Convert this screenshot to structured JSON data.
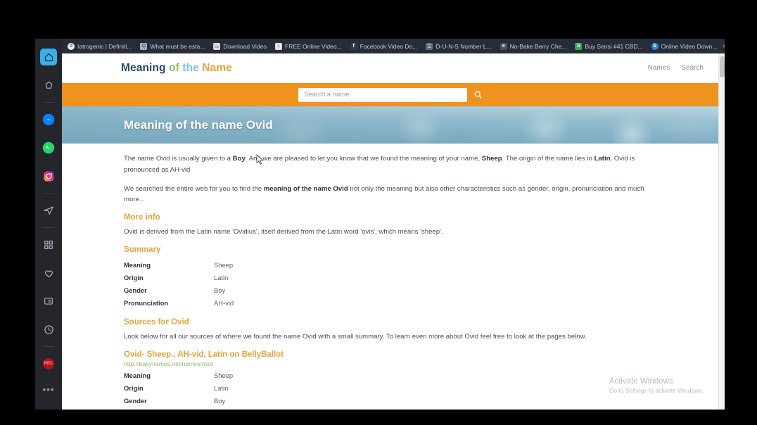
{
  "browser": {
    "bookmarks": [
      {
        "label": "Iatrogenic | Definiti...",
        "icon": "dictionary-icon",
        "color": "#e8e8e8"
      },
      {
        "label": "What must be esta...",
        "icon": "quora-icon",
        "color": "#8fa8c8"
      },
      {
        "label": "Download Video",
        "icon": "document-icon",
        "color": "#dcdcdc"
      },
      {
        "label": "FREE Online Video...",
        "icon": "download-icon",
        "color": "#e0e0e0"
      },
      {
        "label": "Facebook Video Do...",
        "icon": "facebook-icon",
        "color": "#3b5998"
      },
      {
        "label": "D-U-N-S Number L...",
        "icon": "page-icon",
        "color": "#6d7a8a"
      },
      {
        "label": "No-Bake Berry Che...",
        "icon": "recipe-icon",
        "color": "#55606e"
      },
      {
        "label": "Buy Sensi #41 CBD...",
        "icon": "leaf-icon",
        "color": "#3ea35a"
      },
      {
        "label": "Online Video Down...",
        "icon": "blue-s-icon",
        "color": "#2f86d6"
      }
    ],
    "overflow_label": "»"
  },
  "sidebar": {
    "items": [
      {
        "name": "home-icon",
        "label": "Home",
        "active": true
      },
      {
        "name": "star-icon",
        "label": "Favorites",
        "active": false
      },
      {
        "name": "messenger-icon",
        "label": "Messenger",
        "active": false
      },
      {
        "name": "whatsapp-icon",
        "label": "WhatsApp",
        "active": false
      },
      {
        "name": "instagram-icon",
        "label": "Instagram",
        "active": false
      },
      {
        "name": "telegram-icon",
        "label": "Telegram",
        "active": false
      },
      {
        "name": "apps-grid-icon",
        "label": "Apps",
        "active": false
      },
      {
        "name": "heart-icon",
        "label": "Likes",
        "active": false
      },
      {
        "name": "notes-icon",
        "label": "Notes",
        "active": false
      },
      {
        "name": "history-clock-icon",
        "label": "History",
        "active": false
      },
      {
        "name": "record-icon",
        "label": "Record",
        "active": false
      }
    ],
    "more_label": "•••"
  },
  "site": {
    "logo": {
      "word1": "Meaning",
      "word2": "of",
      "word3": "the",
      "word4": "Name"
    },
    "nav": [
      {
        "label": "Names"
      },
      {
        "label": "Search"
      }
    ],
    "search": {
      "placeholder": "Search a name",
      "value": "",
      "button_icon": "search-icon"
    },
    "hero_title": "Meaning of the name Ovid"
  },
  "content": {
    "intro_1": "The name Ovid is usually given to a ",
    "intro_bold_1": "Boy",
    "intro_2": ". And we are pleased to let you know that we found the meaning of your name, ",
    "intro_bold_2": "Sheep",
    "intro_3": ". The origin of the name lies in ",
    "intro_bold_3": "Latin",
    "intro_4": ". Ovid is pronounced as AH-vid",
    "search_1": "We searched the entire web for you to find the ",
    "search_bold": "meaning of the name Ovid",
    "search_2": " not only the meaning but also other characteristics such as gender, origin, pronunciation and much more...",
    "more_info_heading": "More info",
    "more_info_text": "Ovid is derived from the Latin name 'Ovidius', itself derived from the Latin word 'ovis', which means 'sheep'.",
    "summary_heading": "Summary",
    "summary_rows": [
      {
        "key": "Meaning",
        "value": "Sheep"
      },
      {
        "key": "Origin",
        "value": "Latin"
      },
      {
        "key": "Gender",
        "value": "Boy"
      },
      {
        "key": "Pronunciation",
        "value": "AH-vid"
      }
    ],
    "sources_heading": "Sources for Ovid",
    "sources_text": "Look below for all our sources of where we found the name Ovid with a small summary. To learn even more about Ovid feel free to look at the pages below.",
    "source_link_title": "Ovid- Sheep., AH-vid, Latin on BellyBallot",
    "source_link_url": "http://babynames.net/names/ovid",
    "source_rows": [
      {
        "key": "Meaning",
        "value": "Sheep"
      },
      {
        "key": "Origin",
        "value": "Latin"
      },
      {
        "key": "Gender",
        "value": "Boy"
      }
    ]
  },
  "watermark": {
    "title": "Activate Windows",
    "subtitle": "Go to Settings to activate Windows."
  },
  "colors": {
    "accent_orange": "#f0921e",
    "heading_orange": "#e8a33d",
    "link_green": "#93b96b",
    "hero_blue": "#79a8bd",
    "sidebar_active": "#3ab0e8"
  }
}
